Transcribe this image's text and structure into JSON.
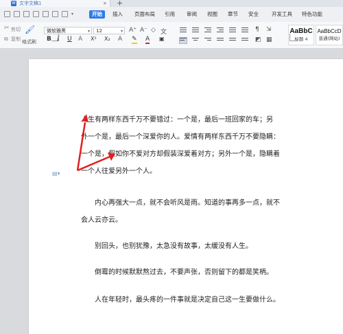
{
  "window": {
    "tab_title": "文字文稿1",
    "tab_close": "×",
    "new_tab": "+",
    "doc_icon": "W"
  },
  "menu": {
    "items": [
      "开始",
      "插入",
      "页面布局",
      "引用",
      "审阅",
      "视图",
      "章节",
      "安全",
      "开发工具",
      "特色功能"
    ],
    "active_index": 0,
    "accent_color": "#2f7be5"
  },
  "ribbon": {
    "clipboard": {
      "cut_label": "剪切",
      "format_painter_label": "格式刷",
      "paste_label": "粘贴"
    },
    "font": {
      "family": "微软雅黑",
      "size": "12"
    },
    "format_buttons": [
      "B",
      "I",
      "U",
      "A",
      "X²",
      "X₂",
      "A",
      "A"
    ],
    "styles": [
      {
        "sample": "AaBbC",
        "caption": "标题 4"
      },
      {
        "sample": "AaBbCcD",
        "caption": "普通(网站)"
      }
    ]
  },
  "document": {
    "paragraphs": [
      [
        "人生有两样东西千万不要错过：一个是，最后一班回家的车；另",
        "外一个是，最后一个深爱你的人。爱情有两样东西千万不要隐瞒：",
        "一个是，假如你不爱对方却假装深爱着对方；另外一个是，隐瞒着",
        "一个人往爱另外一个人。"
      ],
      [
        "　　内心再强大一点，就不会听风是雨。知道的事再多一点，就不",
        "会人云亦云。"
      ],
      [
        "　　别回头，也别犹豫，太急没有故事，太缓没有人生。"
      ],
      [
        "　　倒霉的时候默默熬过去，不要声张，否则留下的都是笑柄。"
      ],
      [
        "　　人在年轻时，最头疼的一件事就是决定自己这一生要做什么。"
      ]
    ]
  },
  "colors": {
    "annotation_arrow": "#e02020",
    "page_background": "#ffffff",
    "workspace_background": "#d8dade"
  },
  "icons": [
    "document-icon",
    "cut-icon",
    "format-painter-icon",
    "paste-icon",
    "clear-format-icon",
    "bullet-list-icon",
    "numbered-list-icon",
    "align-left-icon",
    "align-center-icon",
    "align-right-icon",
    "justify-icon",
    "paragraph-icon"
  ]
}
